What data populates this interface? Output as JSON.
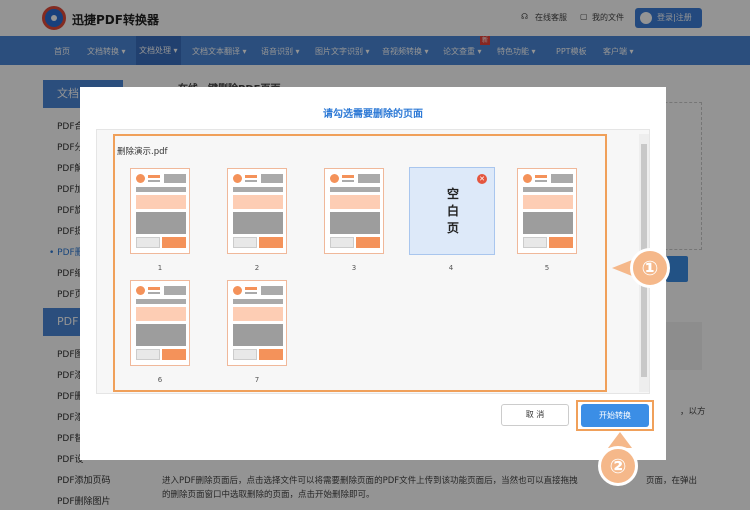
{
  "header": {
    "brand": "迅捷PDF转换器",
    "service": "在线客服",
    "files": "我的文件",
    "login": "登录|注册"
  },
  "nav": {
    "items": [
      "首页",
      "文档转换",
      "文档处理",
      "文档文本翻译",
      "语音识别",
      "图片文字识别",
      "音视频转换",
      "论文查重",
      "特色功能",
      "PPT模板",
      "客户端"
    ],
    "new_badge": "新"
  },
  "sidebar": {
    "section1": "文档",
    "items1": [
      "PDF合",
      "PDF分",
      "PDF解",
      "PDF加",
      "PDF旋",
      "PDF提",
      "• PDF删",
      "PDF缩",
      "PDF页"
    ],
    "section2": "PDF",
    "items2": [
      "PDF图",
      "PDF添",
      "PDF删",
      "PDF添",
      "PDF替",
      "PDF设",
      "PDF添加页码",
      "PDF删除图片"
    ]
  },
  "background": {
    "partial_title": "在线一键删除PDF页面",
    "suffix": "，以方",
    "description_line1": "进入PDF删除页面后，点击选择文件可以将需要删除页面的PDF文件上传到该功能页面后，当然也可以直接拖拽",
    "description_line1_end": "页面，在弹出",
    "description_line2": "的删除页面窗口中选取删除的页面，点击开始删除即可。"
  },
  "modal": {
    "title": "请勾选需要删除的页面",
    "filename": "删除演示.pdf",
    "pages": [
      "1",
      "2",
      "3",
      "4",
      "5",
      "6",
      "7"
    ],
    "blank_page_text": [
      "空",
      "白",
      "页"
    ],
    "cancel": "取 消",
    "start": "开始转换"
  },
  "callouts": [
    "①",
    "②"
  ],
  "colors": {
    "accent": "#4a87d8",
    "highlight": "#f0a05a",
    "callout": "#f5b88a"
  }
}
